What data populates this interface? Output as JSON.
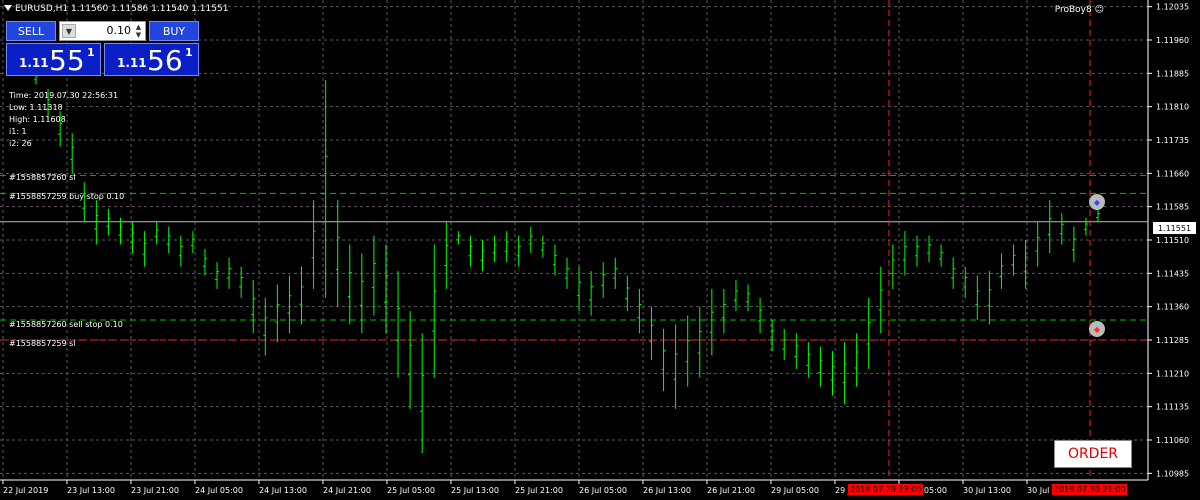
{
  "header": {
    "symbol_line": "EURUSD,H1  1.11560 1.11586 1.11540 1.11551",
    "brand": "ProBoy8"
  },
  "panel": {
    "sell_label": "SELL",
    "buy_label": "BUY",
    "lot_value": "0.10",
    "sell_price": {
      "prefix": "1.11",
      "big": "55",
      "sup": "1"
    },
    "buy_price": {
      "prefix": "1.11",
      "big": "56",
      "sup": "1"
    }
  },
  "info": {
    "time": "Time: 2019.07.30 22:56:31",
    "low": "Low: 1.11318",
    "high": "High: 1.11608",
    "i1": "i1: 1",
    "i2": "i2: 26"
  },
  "order_lines": {
    "buy_sl": "#1558857260 sl",
    "buy_stop": "#1558857259 buy stop 0.10",
    "sell_stop": "#1558857260 sell stop 0.10",
    "sell_sl": "#1558857259 sl"
  },
  "order_button": "ORDER",
  "current_price": "1.11551",
  "red_tags": {
    "left": "2019.07.29 23:00",
    "right": "2019.07.30 21:00"
  },
  "colors": {
    "candle": "#00ff00",
    "grid": "#5a5a5a",
    "sl_line": "#ff2020",
    "stop_line": "#00c000",
    "panel": "#1a3de0"
  },
  "chart_data": {
    "type": "bar",
    "symbol": "EURUSD",
    "timeframe": "H1",
    "y_ticks": [
      "1.12035",
      "1.11960",
      "1.11885",
      "1.11810",
      "1.11735",
      "1.11660",
      "1.11585",
      "1.11510",
      "1.11435",
      "1.11360",
      "1.11285",
      "1.11210",
      "1.11135",
      "1.11060",
      "1.10985"
    ],
    "x_ticks": [
      "22 Jul 2019",
      "23 Jul 13:00",
      "23 Jul 21:00",
      "24 Jul 05:00",
      "24 Jul 13:00",
      "24 Jul 21:00",
      "25 Jul 05:00",
      "25 Jul 13:00",
      "25 Jul 21:00",
      "26 Jul 05:00",
      "26 Jul 13:00",
      "26 Jul 21:00",
      "29 Jul 05:00",
      "29 Jul 13:00",
      "30 Jul 05:00",
      "30 Jul 13:00",
      "30 Jul 21:00"
    ],
    "ylim": [
      1.1097,
      1.1205
    ],
    "levels": {
      "buy_sl": 1.11655,
      "buy_stop": 1.11615,
      "current": 1.11551,
      "sell_stop": 1.1133,
      "sell_sl": 1.11285
    },
    "lows": [
      1.1186,
      1.1178,
      1.1172,
      1.1166,
      1.1155,
      1.115,
      1.1152,
      1.115,
      1.1148,
      1.1145,
      1.115,
      1.1148,
      1.1145,
      1.1148,
      1.1143,
      1.114,
      1.114,
      1.1138,
      1.113,
      1.1125,
      1.1128,
      1.113,
      1.1132,
      1.114,
      1.1138,
      1.1136,
      1.1132,
      1.113,
      1.1134,
      1.113,
      1.112,
      1.1113,
      1.1103,
      1.112,
      1.114,
      1.115,
      1.1145,
      1.1144,
      1.1146,
      1.1146,
      1.1145,
      1.1148,
      1.1147,
      1.1143,
      1.114,
      1.1135,
      1.1134,
      1.1138,
      1.114,
      1.1135,
      1.113,
      1.1124,
      1.1117,
      1.1113,
      1.1118,
      1.112,
      1.1125,
      1.113,
      1.1135,
      1.1135,
      1.113,
      1.1126,
      1.1124,
      1.1122,
      1.112,
      1.1118,
      1.1116,
      1.1114,
      1.1118,
      1.1122,
      1.113,
      1.114,
      1.1143,
      1.1145,
      1.1146,
      1.1145,
      1.114,
      1.1138,
      1.1133,
      1.1132,
      1.114,
      1.1143,
      1.114,
      1.1145,
      1.1148,
      1.115,
      1.1146,
      1.1152,
      1.1155
    ],
    "highs": [
      1.1189,
      1.1185,
      1.118,
      1.1175,
      1.1164,
      1.116,
      1.1158,
      1.1156,
      1.1155,
      1.1153,
      1.1155,
      1.1154,
      1.1152,
      1.1153,
      1.1149,
      1.1146,
      1.1147,
      1.1145,
      1.1142,
      1.1138,
      1.1141,
      1.1143,
      1.1145,
      1.116,
      1.1187,
      1.116,
      1.115,
      1.1148,
      1.1152,
      1.115,
      1.1144,
      1.1135,
      1.113,
      1.115,
      1.1155,
      1.1153,
      1.1152,
      1.1151,
      1.1152,
      1.1153,
      1.1152,
      1.1154,
      1.1152,
      1.115,
      1.1147,
      1.1145,
      1.1144,
      1.1146,
      1.1147,
      1.1143,
      1.114,
      1.1136,
      1.1131,
      1.1132,
      1.1134,
      1.1136,
      1.114,
      1.114,
      1.1142,
      1.1141,
      1.1138,
      1.1133,
      1.1131,
      1.113,
      1.1128,
      1.1127,
      1.1126,
      1.1128,
      1.113,
      1.1138,
      1.1145,
      1.115,
      1.1153,
      1.1152,
      1.1152,
      1.115,
      1.1147,
      1.1145,
      1.1143,
      1.1144,
      1.1148,
      1.115,
      1.1151,
      1.1155,
      1.116,
      1.1157,
      1.1154,
      1.1156,
      1.1158
    ]
  }
}
